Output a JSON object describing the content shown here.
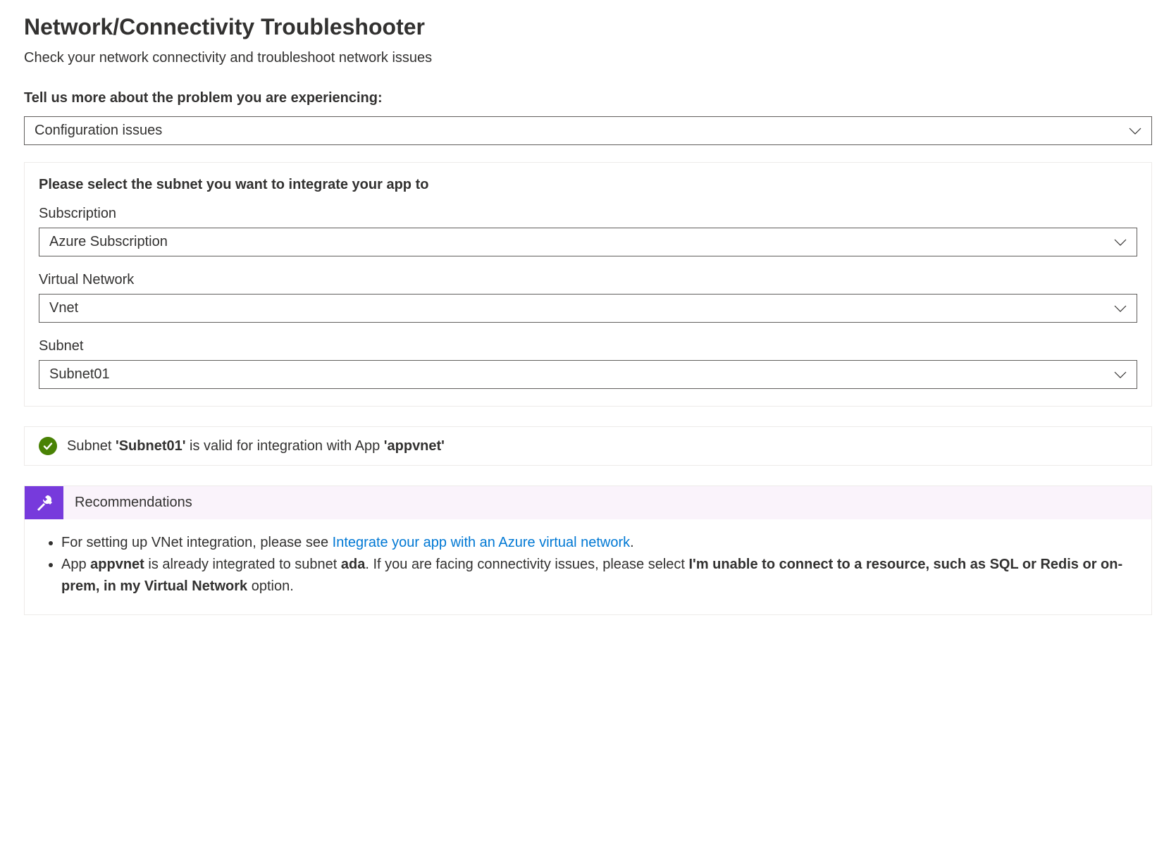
{
  "title": "Network/Connectivity Troubleshooter",
  "subtitle": "Check your network connectivity and troubleshoot network issues",
  "problem": {
    "label": "Tell us more about the problem you are experiencing:",
    "selected": "Configuration issues"
  },
  "subnetPanel": {
    "heading": "Please select the subnet you want to integrate your app to",
    "subscription": {
      "label": "Subscription",
      "value": "Azure Subscription"
    },
    "vnet": {
      "label": "Virtual Network",
      "value": "Vnet"
    },
    "subnet": {
      "label": "Subnet",
      "value": "Subnet01"
    }
  },
  "status": {
    "prefix": "Subnet ",
    "subnetQuoted": "'Subnet01'",
    "middle": " is valid for integration with App ",
    "appQuoted": "'appvnet'"
  },
  "recommendations": {
    "title": "Recommendations",
    "item1": {
      "pre": "For setting up VNet integration, please see ",
      "linkText": "Integrate your app with an Azure virtual network",
      "post": "."
    },
    "item2": {
      "t1": "App ",
      "app": "appvnet",
      "t2": " is already integrated to subnet ",
      "subnet": "ada",
      "t3": ". If you are facing connectivity issues, please select ",
      "optionBold": "I'm unable to connect to a resource, such as SQL or Redis or on-prem, in my Virtual Network",
      "t4": " option."
    }
  }
}
